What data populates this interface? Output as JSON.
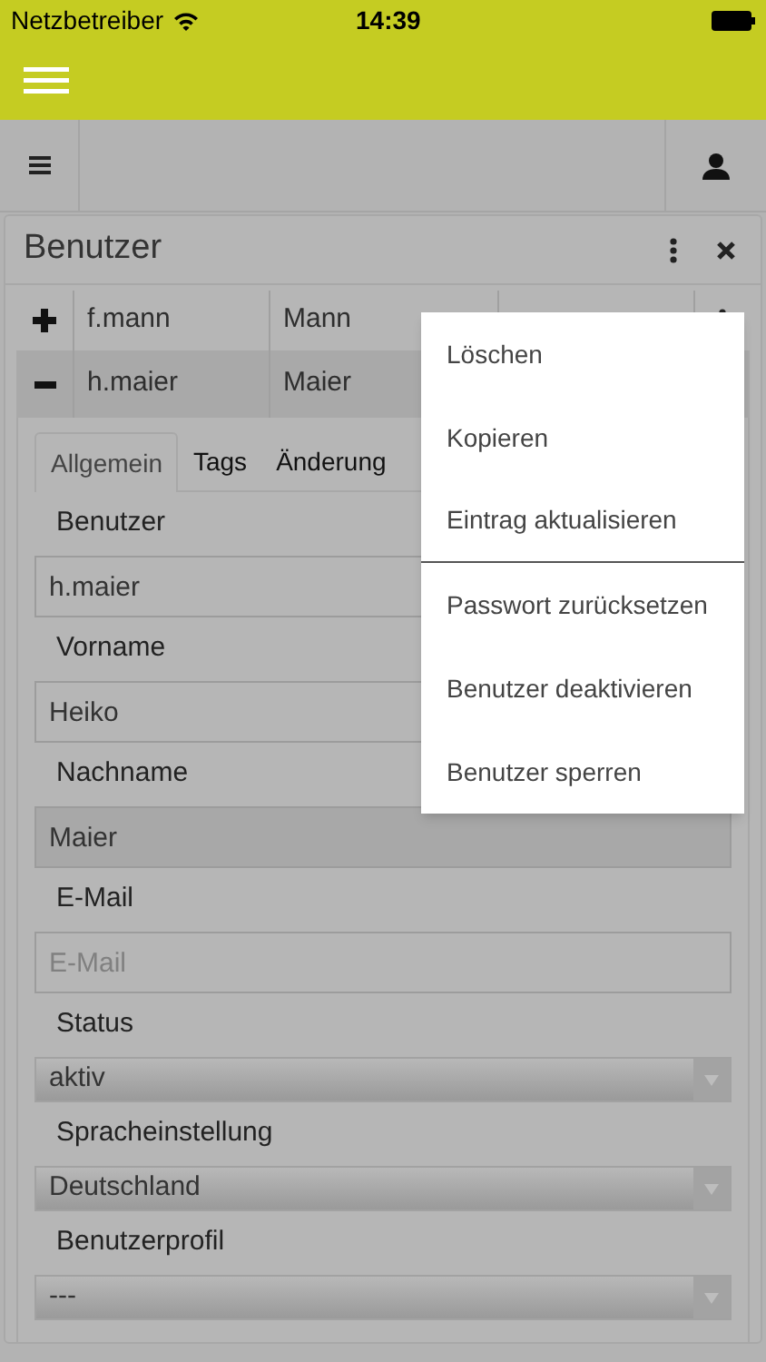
{
  "status_bar": {
    "carrier": "Netzbetreiber",
    "time": "14:39"
  },
  "panel": {
    "title": "Benutzer"
  },
  "table": {
    "rows": [
      {
        "expanded": false,
        "selected": false,
        "column_1": "f.mann",
        "column_2": "Mann"
      },
      {
        "expanded": true,
        "selected": true,
        "column_1": "h.maier",
        "column_2": "Maier"
      }
    ]
  },
  "tabs": [
    {
      "label": "Allgemein",
      "selected": true
    },
    {
      "label": "Tags",
      "selected": false
    },
    {
      "label": "Änderung",
      "selected": false
    }
  ],
  "fields": [
    {
      "label": "Benutzer",
      "kind": "text",
      "value": "h.maier",
      "disabled": false
    },
    {
      "label": "Vorname",
      "kind": "text",
      "value": "Heiko",
      "disabled": false
    },
    {
      "label": "Nachname",
      "kind": "text",
      "value": "Maier",
      "disabled": true
    },
    {
      "label": "E-Mail",
      "kind": "text",
      "placeholder": "E-Mail",
      "disabled": false
    },
    {
      "label": "Status",
      "kind": "select",
      "value": "aktiv"
    },
    {
      "label": "Spracheinstellung",
      "kind": "select",
      "value": "Deutschland"
    },
    {
      "label": "Benutzerprofil",
      "kind": "select",
      "value": "---"
    }
  ],
  "menu": {
    "items": [
      {
        "label": "Löschen",
        "divider_after": false
      },
      {
        "label": "Kopieren",
        "divider_after": false
      },
      {
        "label": "Eintrag aktualisieren",
        "divider_after": true
      },
      {
        "label": "Passwort zurücksetzen",
        "divider_after": false
      },
      {
        "label": "Benutzer deaktivieren",
        "divider_after": false
      },
      {
        "label": "Benutzer sperren",
        "divider_after": false
      }
    ]
  }
}
